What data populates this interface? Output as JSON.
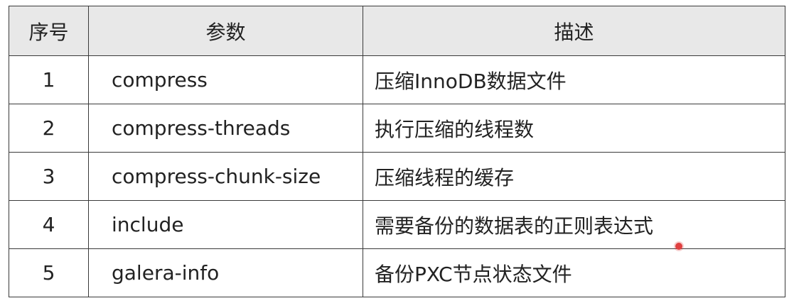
{
  "table": {
    "headers": [
      "序号",
      "参数",
      "描述"
    ],
    "rows": [
      {
        "index": "1",
        "param": "compress",
        "desc": "压缩InnoDB数据文件"
      },
      {
        "index": "2",
        "param": "compress-threads",
        "desc": "执行压缩的线程数"
      },
      {
        "index": "3",
        "param": "compress-chunk-size",
        "desc": "压缩线程的缓存"
      },
      {
        "index": "4",
        "param": "include",
        "desc": "需要备份的数据表的正则表达式"
      },
      {
        "index": "5",
        "param": "galera-info",
        "desc": "备份PXC节点状态文件"
      }
    ]
  },
  "colors": {
    "header_bg": "#e8e8e8",
    "border": "#3a3a3a",
    "cursor": "#e04040"
  }
}
